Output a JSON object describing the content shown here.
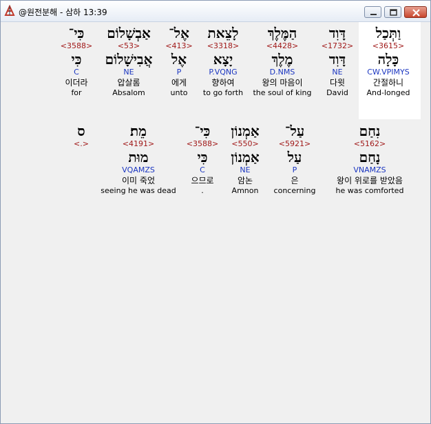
{
  "window": {
    "title": "@원전분해 - 삼하 13:39"
  },
  "rows": [
    {
      "words": [
        {
          "heb": "כִּי־",
          "strong": "<3588>",
          "root": "כִּי",
          "morph": "C",
          "kor": "이더라",
          "eng": "for"
        },
        {
          "heb": "אַבְשָׁלוֹם",
          "strong": "<53>",
          "root": "אֲבִישָׁלוֹם",
          "morph": "NE",
          "kor": "압살롬",
          "eng": "Absalom"
        },
        {
          "heb": "אֶל־",
          "strong": "<413>",
          "root": "אֶל",
          "morph": "P",
          "kor": "에게",
          "eng": "unto"
        },
        {
          "heb": "לָצֵאת",
          "strong": "<3318>",
          "root": "יָצָא",
          "morph": "P.VQNG",
          "kor": "향하여",
          "eng": "to go forth"
        },
        {
          "heb": "הַמֶּלֶךְ",
          "strong": "<4428>",
          "root": "מֶלֶךְ",
          "morph": "D.NMS",
          "kor": "왕의 마음이",
          "eng": "the soul of king"
        },
        {
          "heb": "דָּוִד",
          "strong": "<1732>",
          "root": "דָּוִד",
          "morph": "NE",
          "kor": "다윗",
          "eng": "David"
        },
        {
          "heb": "וַתְּכַל",
          "strong": "<3615>",
          "root": "כָּלָה",
          "morph": "CW.VPIMYS",
          "kor": "간절하니",
          "eng": "And-longed"
        }
      ]
    },
    {
      "words": [
        {
          "heb": "ס",
          "strong": "<.>",
          "root": "",
          "morph": "",
          "kor": "",
          "eng": ""
        },
        {
          "heb": "מֵת׃",
          "strong": "<4191>",
          "root": "מוּת",
          "morph": "VQAMZS",
          "kor": "이미 죽었",
          "eng": "seeing he was dead"
        },
        {
          "heb": "כִּי־",
          "strong": "<3588>",
          "root": "כִּי",
          "morph": "C",
          "kor": "으므로",
          "eng": "."
        },
        {
          "heb": "אַמְנוֹן",
          "strong": "<550>",
          "root": "אַמְנוֹן",
          "morph": "NE",
          "kor": "암논",
          "eng": "Amnon"
        },
        {
          "heb": "עַל־",
          "strong": "<5921>",
          "root": "עַל",
          "morph": "P",
          "kor": "은",
          "eng": "concerning"
        },
        {
          "heb": "נִחַם",
          "strong": "<5162>",
          "root": "נָחַם",
          "morph": "VNAMZS",
          "kor": "왕이 위로를 받았음",
          "eng": "he was comforted"
        }
      ]
    }
  ]
}
